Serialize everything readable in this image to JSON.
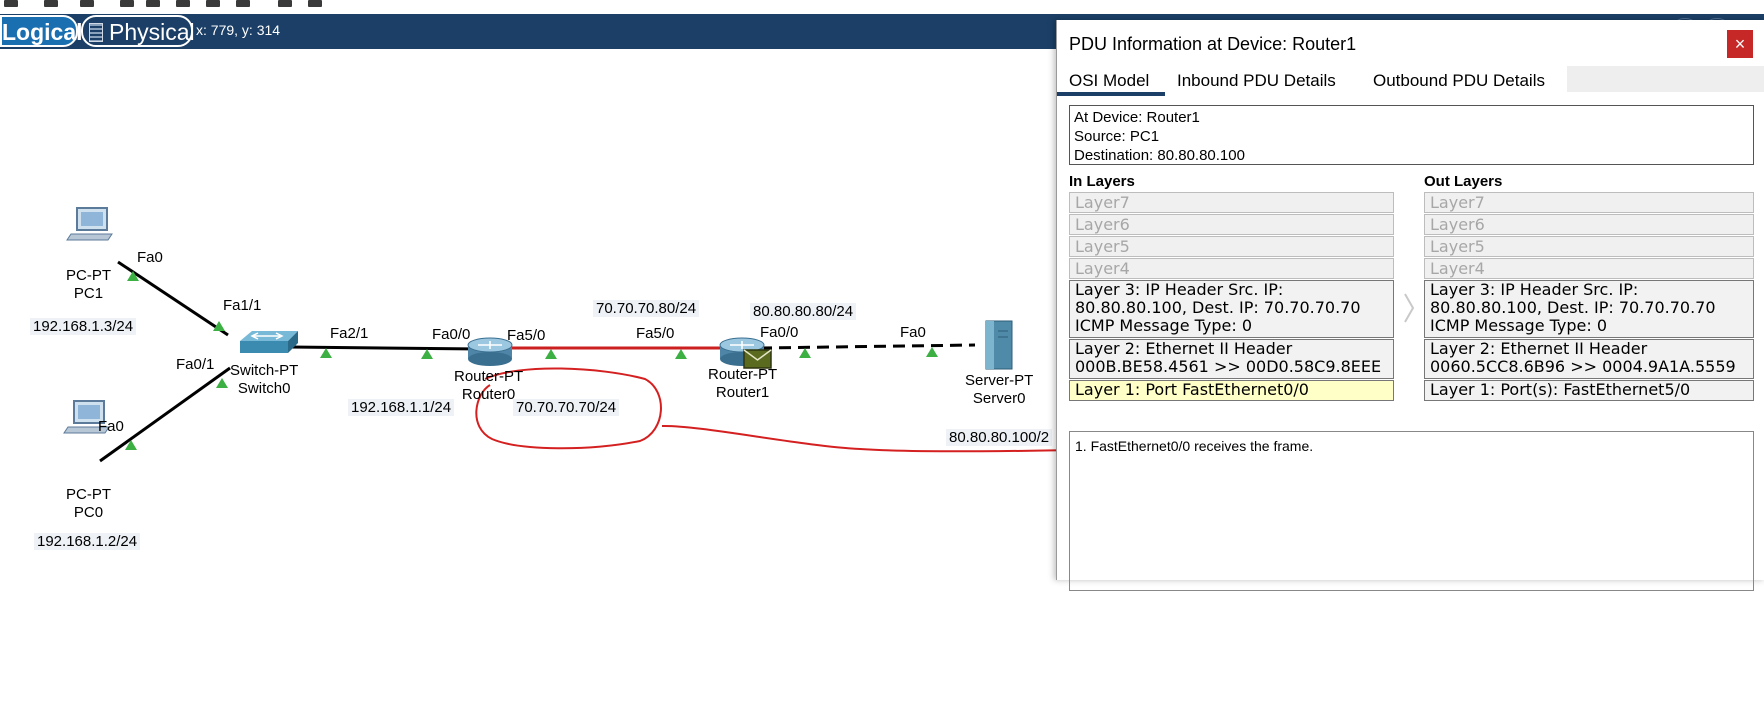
{
  "toolbar": {
    "logical_label": "Logical",
    "physical_label": "Physical",
    "coordinates": "x: 779, y: 314"
  },
  "topology": {
    "devices": [
      {
        "id": "pc1",
        "type": "PC-PT",
        "name": "PC1"
      },
      {
        "id": "pc0",
        "type": "PC-PT",
        "name": "PC0"
      },
      {
        "id": "switch0",
        "type": "Switch-PT",
        "name": "Switch0"
      },
      {
        "id": "router0",
        "type": "Router-PT",
        "name": "Router0"
      },
      {
        "id": "router1",
        "type": "Router-PT",
        "name": "Router1"
      },
      {
        "id": "server0",
        "type": "Server-PT",
        "name": "Server0"
      }
    ],
    "ports": {
      "pc1_fa0": "Fa0",
      "sw_fa1_1": "Fa1/1",
      "sw_fa0_1": "Fa0/1",
      "pc0_fa0": "Fa0",
      "sw_fa2_1": "Fa2/1",
      "r0_fa0_0": "Fa0/0",
      "r0_fa5_0": "Fa5/0",
      "r1_fa5_0": "Fa5/0",
      "r1_fa0_0": "Fa0/0",
      "srv_fa0": "Fa0"
    },
    "ip_labels": {
      "pc1": "192.168.1.3/24",
      "pc0": "192.168.1.2/24",
      "r0_lan": "192.168.1.1/24",
      "r0_wan": "70.70.70.70/24",
      "r1_wan": "70.70.70.80/24",
      "r1_lan": "80.80.80.80/24",
      "server": "80.80.80.100/2"
    },
    "link_colors": {
      "normal": "#000000",
      "highlight": "#cc1f1f",
      "port_up": "#3cb043"
    }
  },
  "pdu_panel": {
    "title": "PDU Information at Device: Router1",
    "close_label": "×",
    "tabs": [
      "OSI Model",
      "Inbound PDU Details",
      "Outbound PDU Details"
    ],
    "active_tab": "OSI Model",
    "info_lines": [
      "At Device: Router1",
      "Source: PC1",
      "Destination: 80.80.80.100"
    ],
    "in_layers_label": "In Layers",
    "out_layers_label": "Out Layers",
    "in_layers": {
      "l7": "Layer7",
      "l6": "Layer6",
      "l5": "Layer5",
      "l4": "Layer4",
      "l3": [
        "Layer 3: IP Header Src. IP:",
        "80.80.80.100, Dest. IP: 70.70.70.70",
        "ICMP Message Type: 0"
      ],
      "l2": [
        "Layer 2: Ethernet II Header",
        "000B.BE58.4561 >> 00D0.58C9.8EEE"
      ],
      "l1": "Layer 1: Port FastEthernet0/0"
    },
    "out_layers": {
      "l7": "Layer7",
      "l6": "Layer6",
      "l5": "Layer5",
      "l4": "Layer4",
      "l3": [
        "Layer 3: IP Header Src. IP:",
        "80.80.80.100, Dest. IP: 70.70.70.70",
        "ICMP Message Type: 0"
      ],
      "l2": [
        "Layer 2: Ethernet II Header",
        "0060.5CC8.6B96 >> 0004.9A1A.5559"
      ],
      "l1": "Layer 1: Port(s): FastEthernet5/0"
    },
    "description": "1. FastEthernet0/0 receives the frame."
  },
  "annotation_color": "#d42020"
}
